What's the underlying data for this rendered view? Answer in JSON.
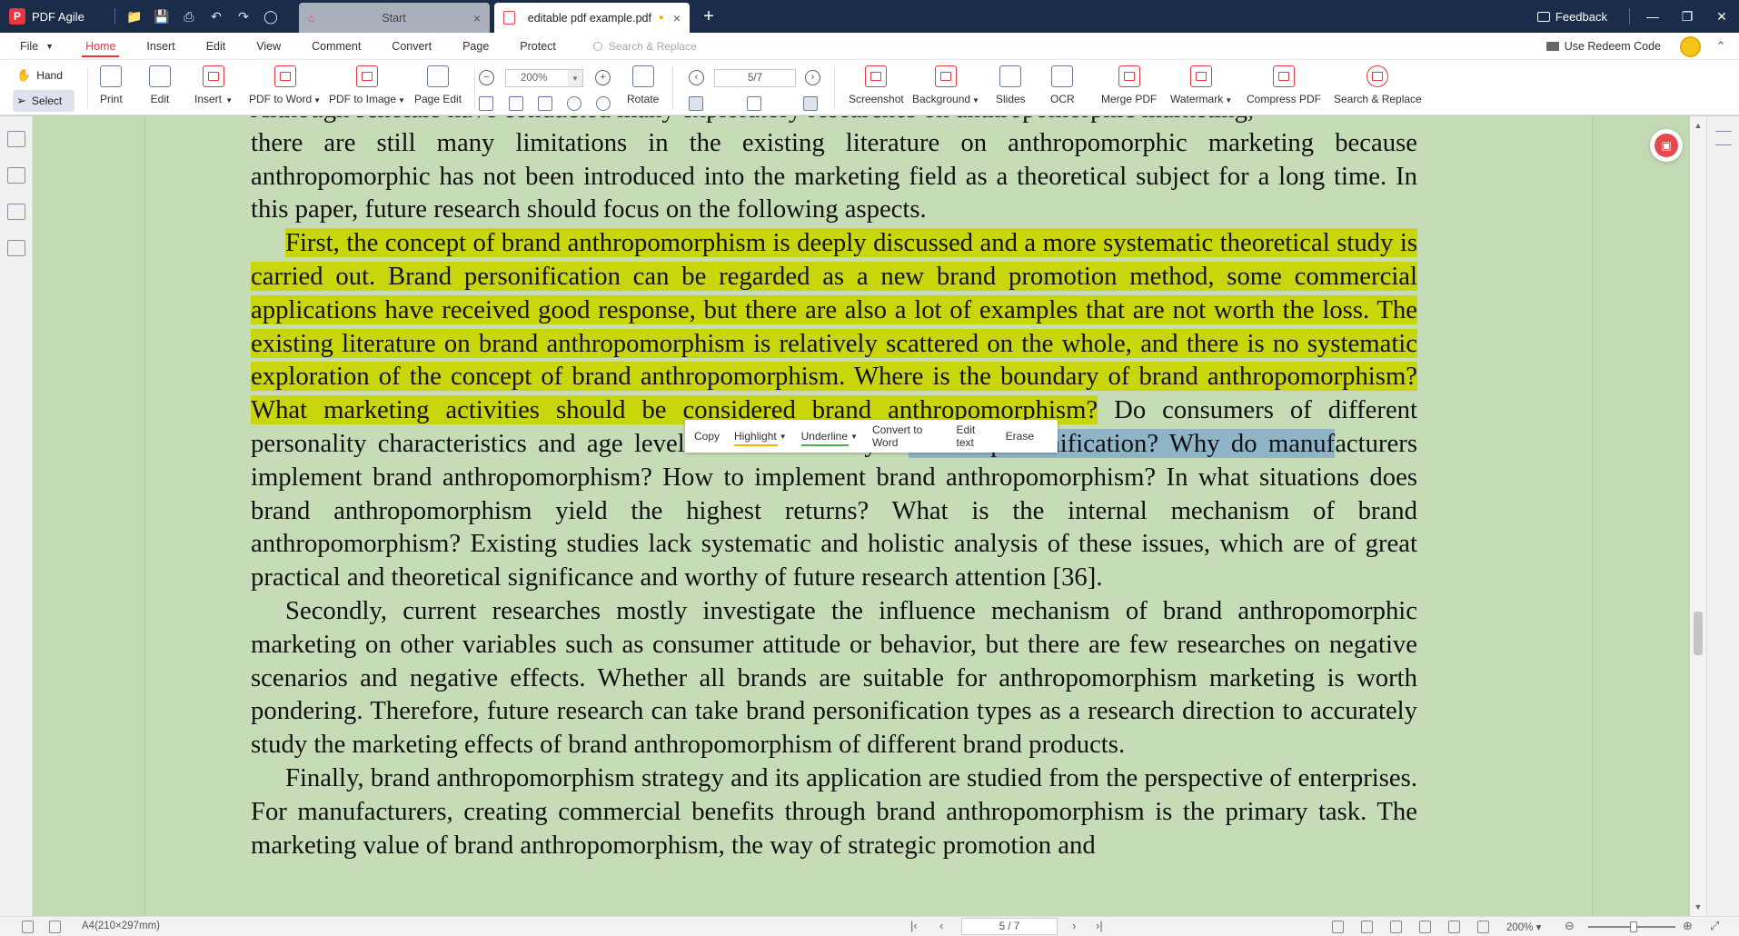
{
  "app": {
    "name": "PDF Agile",
    "logo_letter": "P",
    "tabs": [
      {
        "label": "Start"
      },
      {
        "label": "editable pdf example.pdf"
      }
    ],
    "feedback_label": "Feedback"
  },
  "menu": {
    "file_label": "File",
    "items": [
      "Home",
      "Insert",
      "Edit",
      "View",
      "Comment",
      "Convert",
      "Page",
      "Protect"
    ],
    "search_placeholder": "Search & Replace",
    "redeem_label": "Use Redeem Code"
  },
  "ribbon": {
    "hand_label": "Hand",
    "select_label": "Select",
    "print_label": "Print",
    "edit_label": "Edit",
    "insert_label": "Insert",
    "pdf_to_word_label": "PDF to Word",
    "pdf_to_image_label": "PDF to Image",
    "page_edit_label": "Page Edit",
    "zoom_value": "200%",
    "rotate_label": "Rotate",
    "page_value": "5/7",
    "screenshot_label": "Screenshot",
    "background_label": "Background",
    "slides_label": "Slides",
    "ocr_label": "OCR",
    "merge_pdf_label": "Merge PDF",
    "watermark_label": "Watermark",
    "compress_pdf_label": "Compress PDF",
    "search_replace_label": "Search & Replace"
  },
  "context_menu": {
    "copy": "Copy",
    "highlight": "Highlight",
    "underline": "Underline",
    "convert_to_word": "Convert to Word",
    "edit_text": "Edit text",
    "erase": "Erase"
  },
  "document": {
    "line0": "Although scholars have conducted many exploratory researches on anthropomorphic marketing,",
    "p1": "there are still many limitations in the existing literature on anthropomorphic marketing because anthropomorphic has not been introduced into the marketing field as a theoretical subject for a long time. In this paper, future research should focus on the following aspects.",
    "p2_highlighted": "First, the concept of brand anthropomorphism is deeply discussed and a more systematic theoretical study is carried out. Brand personification can be regarded as a new brand promotion method, some commercial applications have received good response, but there are also a lot of examples that are not worth the loss. The existing literature on brand anthropomorphism is relatively scattered on the whole, and there is no systematic exploration of the concept of brand anthropomorphism. Where is the boundary of brand anthropomorphism? What marketing activities should be considered brand anthropomorphism?",
    "p2_plain_a": " Do consumers of different personality characteristics and age levels react differently to",
    "p2_selected": " brand personification? Why do manuf",
    "p2_plain_b": "acturers implement brand anthropomorphism? How to implement brand anthropomorphism? In what situations does brand anthropomorphism yield the highest returns? What is the internal mechanism of brand anthropomorphism? Existing studies lack systematic and holistic analysis of these issues, which are of great practical and theoretical significance and worthy of future research attention [36].",
    "p3": "Secondly, current researches mostly investigate the influence mechanism of brand anthropomorphic marketing on other variables such as consumer attitude or behavior, but there are few researches on negative scenarios and negative effects. Whether all brands are suitable for anthropomorphism marketing is worth pondering. Therefore, future research can take brand personification types as a research direction to accurately study the marketing effects of brand anthropomorphism of different brand products.",
    "p4": "Finally, brand anthropomorphism strategy and its application are studied from the perspective of enterprises. For manufacturers, creating commercial benefits through brand anthropomorphism is the primary task. The marketing value of brand anthropomorphism, the way of strategic promotion and"
  },
  "status": {
    "page_size": "A4(210×297mm)",
    "page_value": "5 / 7",
    "zoom": "200%"
  },
  "colors": {
    "titlebar": "#1b2b4a",
    "accent": "#e8373f",
    "highlight": "#c9d60c",
    "selection": "#8fb4c8",
    "page_bg": "#c6dcb6"
  }
}
